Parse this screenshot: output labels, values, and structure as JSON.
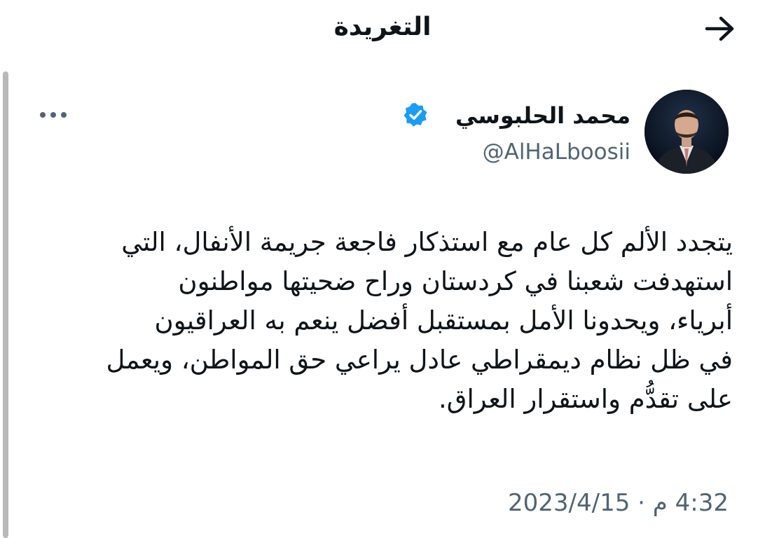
{
  "header": {
    "title": "التغريدة",
    "back_icon": "arrow-right-icon"
  },
  "tweet": {
    "author": {
      "name": "محمد الحلبوسي",
      "handle": "@AlHaLboosii",
      "verified_icon": "verified-badge-icon"
    },
    "more_icon": "more-horizontal-icon",
    "text_lines": [
      "يتجدد الألم كل عام مع استذكار فاجعة جريمة الأنفال، التي",
      "استهدفت شعبنا في كردستان وراح ضحيتها مواطنون",
      "أبرياء، ويحدونا الأمل بمستقبل أفضل ينعم به العراقيون",
      "في ظل نظام ديمقراطي عادل يراعي حق المواطن، ويعمل",
      "على تقدُّم واستقرار العراق."
    ],
    "timestamp": "4:32 م · 2023/4/15"
  },
  "colors": {
    "text_primary": "#0f1419",
    "text_secondary": "#536471",
    "verified_blue": "#1d9bf0",
    "scroll_bar": "#b9b9b9"
  }
}
